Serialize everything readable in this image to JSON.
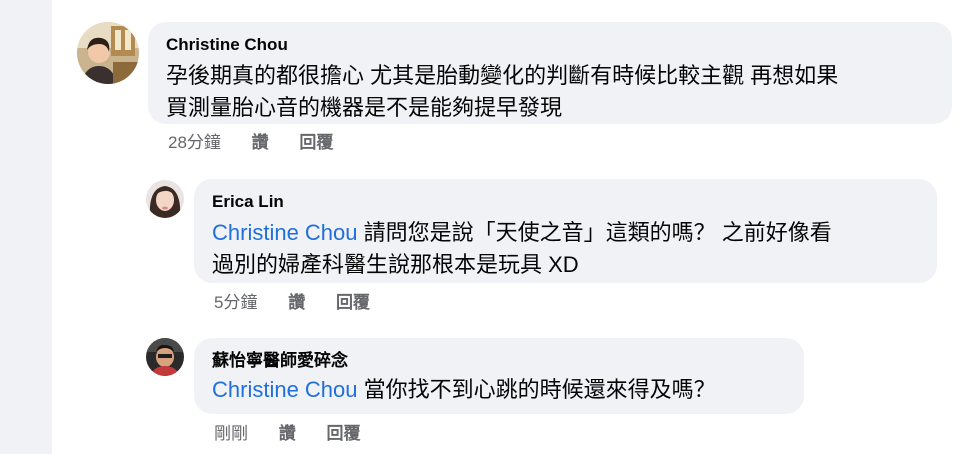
{
  "comments": [
    {
      "author": "Christine Chou",
      "text": "孕後期真的都很擔心 尤其是胎動變化的判斷有時候比較主觀 再想如果買測量胎心音的機器是不是能夠提早發現",
      "line1": "孕後期真的都很擔心 尤其是胎動變化的判斷有時候比較主觀 再想如果",
      "line2": "買測量胎心音的機器是不是能夠提早發現",
      "time": "28分鐘",
      "like": "讚",
      "reply": "回覆"
    },
    {
      "author": "Erica Lin",
      "mention": "Christine Chou",
      "line1": " 請問您是說「天使之音」這類的嗎？ 之前好像看",
      "line2": "過別的婦產科醫生說那根本是玩具 XD",
      "time": "5分鐘",
      "like": "讚",
      "reply": "回覆"
    },
    {
      "author": "蘇怡寧醫師愛碎念",
      "mention": "Christine Chou",
      "line1": " 當你找不到心跳的時候還來得及嗎？",
      "time": "剛剛",
      "like": "讚",
      "reply": "回覆"
    }
  ]
}
